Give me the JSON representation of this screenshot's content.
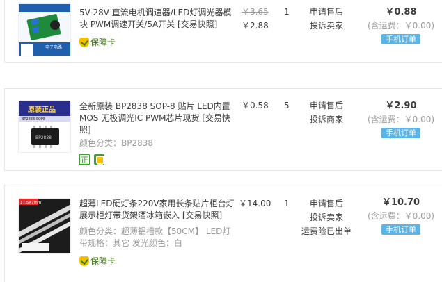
{
  "orders": [
    {
      "title": "5V-28V 直流电机调速器/LED灯调光器模块 PWM调速开关/5A开关 [交易快照]",
      "meta": [],
      "guarantee_label": "保障卡",
      "price_old": "￥3.65",
      "price_new": "￥2.88",
      "qty": "1",
      "actions": [
        "申请售后",
        "投诉卖家"
      ],
      "total": "￥0.88",
      "shipping": "(含运费：￥0.00)",
      "mobile_order": "手机订单",
      "thumb_text": "电子电路"
    },
    {
      "title": "全新原装 BP2838 SOP-8 贴片 LED内置MOS 无极调光IC PWM芯片现货 [交易快照]",
      "meta": [
        "颜色分类：BP2838"
      ],
      "badge_zheng": "正",
      "price_old": "",
      "price_new": "￥0.58",
      "qty": "5",
      "actions": [
        "申请售后",
        "投诉商家"
      ],
      "total": "￥2.90",
      "shipping": "(含运费：￥0.00)",
      "mobile_order": "手机订单",
      "thumb_banner": "原装正品",
      "thumb_labels": [
        "BP2838 SOP8",
        "BP2838"
      ]
    },
    {
      "title": "超薄LED硬灯条220V家用长条贴片柜台灯展示柜灯带货架酒冰箱嵌入 [交易快照]",
      "meta": [
        "颜色分类：超薄铝槽款【50CM】 LED灯",
        "带规格：其它  发光颜色：白"
      ],
      "guarantee_label": "保障卡",
      "price_old": "",
      "price_new": "￥14.00",
      "qty": "1",
      "actions": [
        "申请售后",
        "投诉卖家",
        "运费险已出单"
      ],
      "total": "￥10.70",
      "shipping": "(含运费：￥0.00)",
      "mobile_order": "手机订单",
      "thumb_label": "17.5X7mm"
    }
  ]
}
